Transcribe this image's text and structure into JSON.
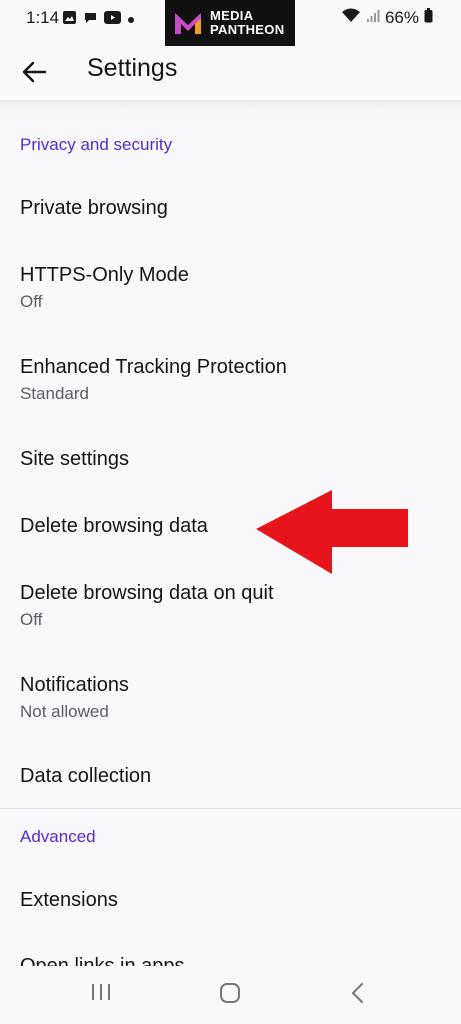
{
  "status_bar": {
    "time": "1:14",
    "battery": "66%",
    "left_icons": [
      "image-icon",
      "chat-icon",
      "youtube-icon",
      "dot-icon"
    ],
    "right_icons": [
      "wifi-icon",
      "signal-icon",
      "battery-icon"
    ]
  },
  "watermark": {
    "line1": "MEDIA",
    "line2": "PANTHEON"
  },
  "app_bar": {
    "title": "Settings"
  },
  "sections": {
    "privacy": "Privacy and security",
    "advanced": "Advanced"
  },
  "items": {
    "private_browsing": {
      "title": "Private browsing"
    },
    "https_only": {
      "title": "HTTPS-Only Mode",
      "sub": "Off"
    },
    "tracking": {
      "title": "Enhanced Tracking Protection",
      "sub": "Standard"
    },
    "site_settings": {
      "title": "Site settings"
    },
    "delete_data": {
      "title": "Delete browsing data"
    },
    "delete_on_quit": {
      "title": "Delete browsing data on quit",
      "sub": "Off"
    },
    "notifications": {
      "title": "Notifications",
      "sub": "Not allowed"
    },
    "data_collection": {
      "title": "Data collection"
    },
    "extensions": {
      "title": "Extensions"
    },
    "open_links": {
      "title": "Open links in apps"
    }
  },
  "colors": {
    "accent": "#592acb",
    "arrow": "#e8141c",
    "background": "#f9f9fb"
  }
}
